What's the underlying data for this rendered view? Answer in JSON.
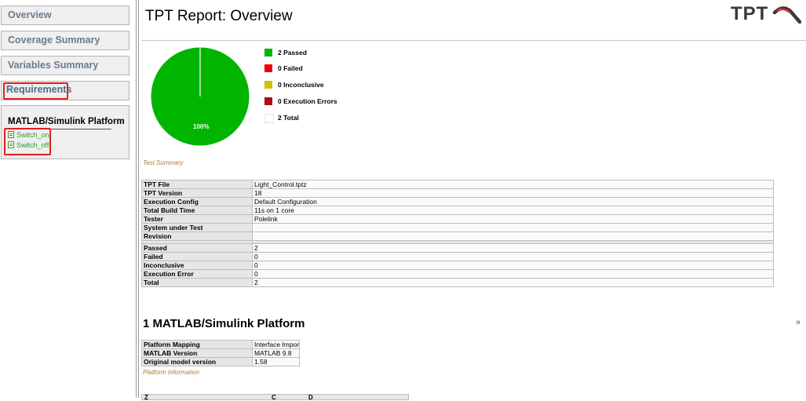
{
  "sidebar": {
    "nav": [
      "Overview",
      "Coverage Summary",
      "Variables Summary",
      "Requirements"
    ],
    "platform_title": "MATLAB/Simulink Platform",
    "test_cases": [
      "Switch_on",
      "Switch_off"
    ]
  },
  "header": {
    "title": "TPT Report: Overview",
    "logo_text": "TPT"
  },
  "chart_data": {
    "type": "pie",
    "slices": [
      {
        "label": "Passed",
        "value": 2,
        "color": "#00b400"
      },
      {
        "label": "Failed",
        "value": 0,
        "color": "#ee0000"
      },
      {
        "label": "Inconclusive",
        "value": 0,
        "color": "#d6c000"
      },
      {
        "label": "Execution Errors",
        "value": 0,
        "color": "#aa1010"
      }
    ],
    "total": 2,
    "pie_label": "100%"
  },
  "legend": [
    {
      "count": "2",
      "label": "Passed",
      "color": "#00b400"
    },
    {
      "count": "0",
      "label": "Failed",
      "color": "#ee0000"
    },
    {
      "count": "0",
      "label": "Inconclusive",
      "color": "#d6c000"
    },
    {
      "count": "0",
      "label": "Execution Errors",
      "color": "#aa1010"
    },
    {
      "count": "2",
      "label": "Total",
      "color": "#ffffff"
    }
  ],
  "summary_caption": "Test Summary",
  "summary_table": {
    "info_rows": [
      [
        "TPT File",
        "Light_Control.tptz"
      ],
      [
        "TPT Version",
        "18"
      ],
      [
        "Execution Config",
        "Default Configuration"
      ],
      [
        "Total Build Time",
        "11s on 1 core"
      ],
      [
        "Tester",
        "Polelink"
      ],
      [
        "System under Test",
        ""
      ],
      [
        "Revision",
        ""
      ]
    ],
    "result_rows": [
      [
        "Passed",
        "2"
      ],
      [
        "Failed",
        "0"
      ],
      [
        "Inconclusive",
        "0"
      ],
      [
        "Execution Error",
        "0"
      ],
      [
        "Total",
        "2"
      ]
    ]
  },
  "section": {
    "title": "1 MATLAB/Simulink Platform"
  },
  "platform_table": [
    [
      "Platform Mapping",
      "Interface Import"
    ],
    [
      "MATLAB Version",
      "MATLAB 9.8"
    ],
    [
      "Original model version",
      "1.58"
    ]
  ],
  "platform_caption": "Platform Information",
  "bottom_table_headers": [
    "Z",
    "C",
    "D"
  ]
}
